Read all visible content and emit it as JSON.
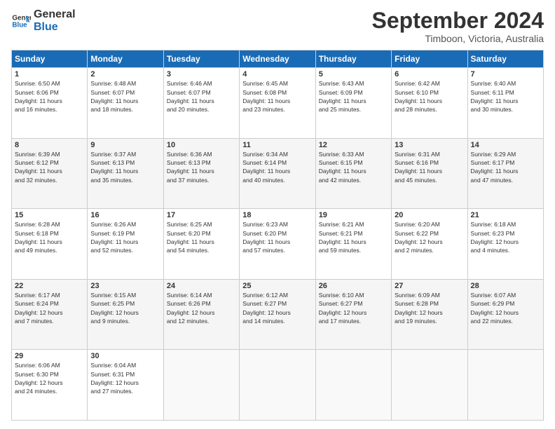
{
  "logo": {
    "line1": "General",
    "line2": "Blue"
  },
  "title": "September 2024",
  "location": "Timboon, Victoria, Australia",
  "days_header": [
    "Sunday",
    "Monday",
    "Tuesday",
    "Wednesday",
    "Thursday",
    "Friday",
    "Saturday"
  ],
  "weeks": [
    [
      {
        "day": "1",
        "info": "Sunrise: 6:50 AM\nSunset: 6:06 PM\nDaylight: 11 hours\nand 16 minutes."
      },
      {
        "day": "2",
        "info": "Sunrise: 6:48 AM\nSunset: 6:07 PM\nDaylight: 11 hours\nand 18 minutes."
      },
      {
        "day": "3",
        "info": "Sunrise: 6:46 AM\nSunset: 6:07 PM\nDaylight: 11 hours\nand 20 minutes."
      },
      {
        "day": "4",
        "info": "Sunrise: 6:45 AM\nSunset: 6:08 PM\nDaylight: 11 hours\nand 23 minutes."
      },
      {
        "day": "5",
        "info": "Sunrise: 6:43 AM\nSunset: 6:09 PM\nDaylight: 11 hours\nand 25 minutes."
      },
      {
        "day": "6",
        "info": "Sunrise: 6:42 AM\nSunset: 6:10 PM\nDaylight: 11 hours\nand 28 minutes."
      },
      {
        "day": "7",
        "info": "Sunrise: 6:40 AM\nSunset: 6:11 PM\nDaylight: 11 hours\nand 30 minutes."
      }
    ],
    [
      {
        "day": "8",
        "info": "Sunrise: 6:39 AM\nSunset: 6:12 PM\nDaylight: 11 hours\nand 32 minutes."
      },
      {
        "day": "9",
        "info": "Sunrise: 6:37 AM\nSunset: 6:13 PM\nDaylight: 11 hours\nand 35 minutes."
      },
      {
        "day": "10",
        "info": "Sunrise: 6:36 AM\nSunset: 6:13 PM\nDaylight: 11 hours\nand 37 minutes."
      },
      {
        "day": "11",
        "info": "Sunrise: 6:34 AM\nSunset: 6:14 PM\nDaylight: 11 hours\nand 40 minutes."
      },
      {
        "day": "12",
        "info": "Sunrise: 6:33 AM\nSunset: 6:15 PM\nDaylight: 11 hours\nand 42 minutes."
      },
      {
        "day": "13",
        "info": "Sunrise: 6:31 AM\nSunset: 6:16 PM\nDaylight: 11 hours\nand 45 minutes."
      },
      {
        "day": "14",
        "info": "Sunrise: 6:29 AM\nSunset: 6:17 PM\nDaylight: 11 hours\nand 47 minutes."
      }
    ],
    [
      {
        "day": "15",
        "info": "Sunrise: 6:28 AM\nSunset: 6:18 PM\nDaylight: 11 hours\nand 49 minutes."
      },
      {
        "day": "16",
        "info": "Sunrise: 6:26 AM\nSunset: 6:19 PM\nDaylight: 11 hours\nand 52 minutes."
      },
      {
        "day": "17",
        "info": "Sunrise: 6:25 AM\nSunset: 6:20 PM\nDaylight: 11 hours\nand 54 minutes."
      },
      {
        "day": "18",
        "info": "Sunrise: 6:23 AM\nSunset: 6:20 PM\nDaylight: 11 hours\nand 57 minutes."
      },
      {
        "day": "19",
        "info": "Sunrise: 6:21 AM\nSunset: 6:21 PM\nDaylight: 11 hours\nand 59 minutes."
      },
      {
        "day": "20",
        "info": "Sunrise: 6:20 AM\nSunset: 6:22 PM\nDaylight: 12 hours\nand 2 minutes."
      },
      {
        "day": "21",
        "info": "Sunrise: 6:18 AM\nSunset: 6:23 PM\nDaylight: 12 hours\nand 4 minutes."
      }
    ],
    [
      {
        "day": "22",
        "info": "Sunrise: 6:17 AM\nSunset: 6:24 PM\nDaylight: 12 hours\nand 7 minutes."
      },
      {
        "day": "23",
        "info": "Sunrise: 6:15 AM\nSunset: 6:25 PM\nDaylight: 12 hours\nand 9 minutes."
      },
      {
        "day": "24",
        "info": "Sunrise: 6:14 AM\nSunset: 6:26 PM\nDaylight: 12 hours\nand 12 minutes."
      },
      {
        "day": "25",
        "info": "Sunrise: 6:12 AM\nSunset: 6:27 PM\nDaylight: 12 hours\nand 14 minutes."
      },
      {
        "day": "26",
        "info": "Sunrise: 6:10 AM\nSunset: 6:27 PM\nDaylight: 12 hours\nand 17 minutes."
      },
      {
        "day": "27",
        "info": "Sunrise: 6:09 AM\nSunset: 6:28 PM\nDaylight: 12 hours\nand 19 minutes."
      },
      {
        "day": "28",
        "info": "Sunrise: 6:07 AM\nSunset: 6:29 PM\nDaylight: 12 hours\nand 22 minutes."
      }
    ],
    [
      {
        "day": "29",
        "info": "Sunrise: 6:06 AM\nSunset: 6:30 PM\nDaylight: 12 hours\nand 24 minutes."
      },
      {
        "day": "30",
        "info": "Sunrise: 6:04 AM\nSunset: 6:31 PM\nDaylight: 12 hours\nand 27 minutes."
      },
      {
        "day": "",
        "info": ""
      },
      {
        "day": "",
        "info": ""
      },
      {
        "day": "",
        "info": ""
      },
      {
        "day": "",
        "info": ""
      },
      {
        "day": "",
        "info": ""
      }
    ]
  ]
}
